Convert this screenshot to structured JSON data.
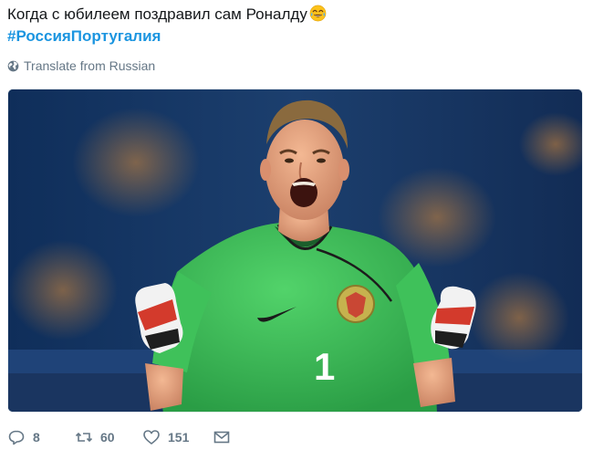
{
  "tweet": {
    "text": "Когда с юбилеем поздравил сам Роналду",
    "emoji": "tears-of-joy-emoji",
    "hashtag": "#РоссияПортугалия"
  },
  "translate": {
    "label": "Translate from Russian",
    "icon": "globe-icon"
  },
  "media": {
    "alt": "photo",
    "jersey_number": "1"
  },
  "actions": {
    "replies": "8",
    "retweets": "60",
    "likes": "151"
  },
  "colors": {
    "hashtag": "#1b95e0",
    "muted": "#657786",
    "jersey": "#3fc15a"
  }
}
